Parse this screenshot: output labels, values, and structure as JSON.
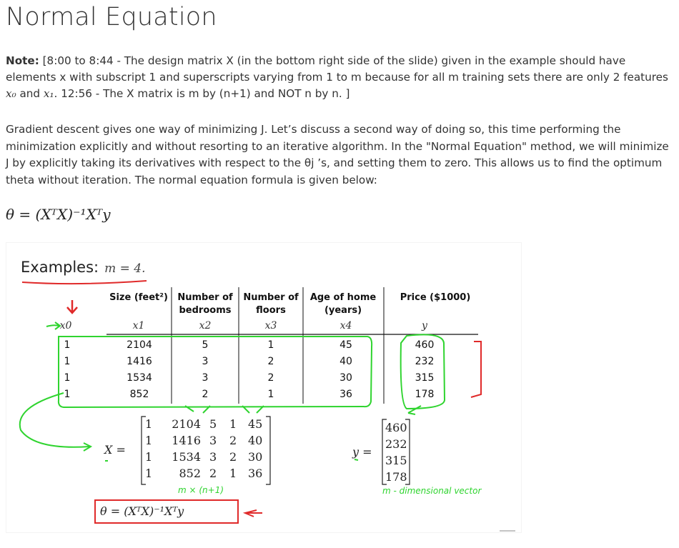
{
  "title": "Normal Equation",
  "note": {
    "label": "Note:",
    "text_a": " [8:00 to 8:44 - The design matrix X (in the bottom right side of the slide) given in the example should have elements x with subscript 1 and superscripts varying from 1 to m because for all m training sets there are only 2 features ",
    "x0": "x₀",
    "and": " and ",
    "x1": "x₁",
    "text_b": ". 12:56 - The X matrix is m by (n+1) and NOT n by n. ]"
  },
  "paragraph": "Gradient descent gives one way of minimizing J. Let’s discuss a second way of doing so, this time performing the minimization explicitly and without resorting to an iterative algorithm. In the \"Normal Equation\" method, we will minimize J by explicitly taking its derivatives with respect to the θj ’s, and setting them to zero. This allows us to find the optimum theta without iteration. The normal equation formula is given below:",
  "formula": "θ = (XᵀX)⁻¹Xᵀy",
  "slide": {
    "examples_label": "Examples:",
    "m_eq": "m = 4.",
    "headers": [
      "Size (feet²)",
      "Number of bedrooms",
      "Number of floors",
      "Age of home (years)",
      "Price ($1000)"
    ],
    "vars": [
      "x0",
      "x1",
      "x2",
      "x3",
      "x4",
      "y"
    ],
    "rows": [
      [
        "1",
        "2104",
        "5",
        "1",
        "45",
        "460"
      ],
      [
        "1",
        "1416",
        "3",
        "2",
        "40",
        "232"
      ],
      [
        "1",
        "1534",
        "3",
        "2",
        "30",
        "315"
      ],
      [
        "1",
        "852",
        "2",
        "1",
        "36",
        "178"
      ]
    ],
    "x_label": "X =",
    "y_label": "y =",
    "x_matrix": [
      [
        "1",
        "2104",
        "5",
        "1",
        "45"
      ],
      [
        "1",
        "1416",
        "3",
        "2",
        "40"
      ],
      [
        "1",
        "1534",
        "3",
        "2",
        "30"
      ],
      [
        "1",
        "852",
        "2",
        "1",
        "36"
      ]
    ],
    "y_vector": [
      "460",
      "232",
      "315",
      "178"
    ],
    "annot_mxn": "m × (n+1)",
    "annot_vec": "m - dimensional vector",
    "boxed_formula": "θ = (XᵀX)⁻¹Xᵀy"
  }
}
